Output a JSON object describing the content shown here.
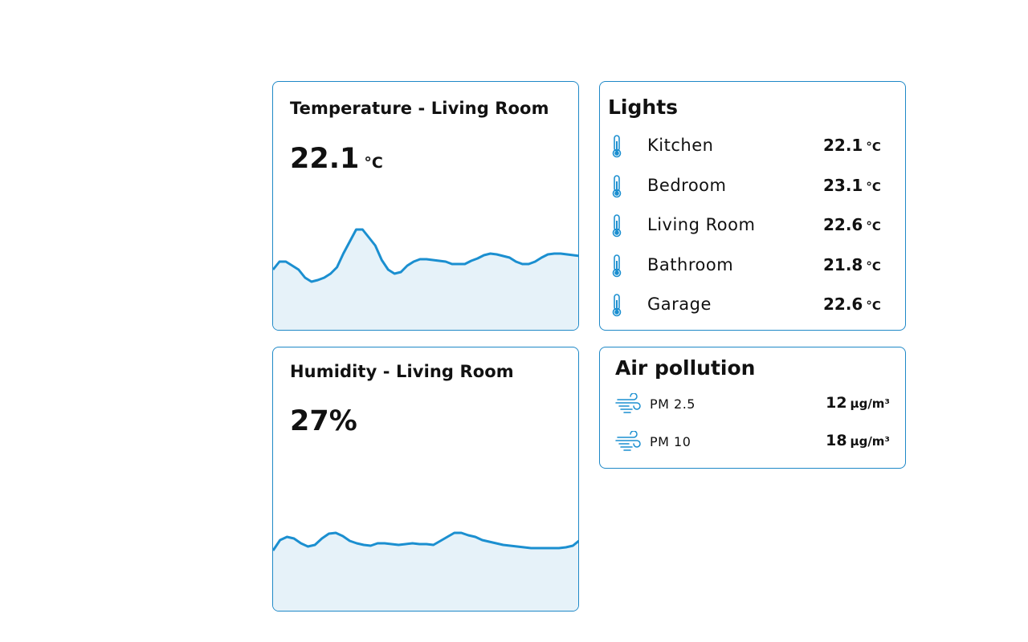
{
  "temperature_card": {
    "title": "Temperature - Living Room",
    "value": "22.1",
    "unit": "°C",
    "trend": [
      75,
      85,
      85,
      80,
      75,
      65,
      60,
      62,
      65,
      70,
      78,
      95,
      110,
      125,
      125,
      115,
      105,
      87,
      75,
      70,
      72,
      80,
      85,
      88,
      88,
      87,
      86,
      85,
      82,
      82,
      82,
      86,
      89,
      93,
      95,
      94,
      92,
      90,
      85,
      82,
      82,
      85,
      90,
      94,
      95,
      95,
      94,
      93,
      92
    ]
  },
  "humidity_card": {
    "title": "Humidity - Living Room",
    "value": "27%",
    "trend": [
      75,
      88,
      92,
      90,
      84,
      80,
      82,
      90,
      96,
      97,
      93,
      87,
      84,
      82,
      81,
      84,
      84,
      83,
      82,
      83,
      84,
      83,
      83,
      82,
      87,
      92,
      97,
      97,
      94,
      92,
      88,
      86,
      84,
      82,
      81,
      80,
      79,
      78,
      78,
      78,
      78,
      78,
      79,
      81,
      88
    ]
  },
  "lights_card": {
    "title": "Lights",
    "items": [
      {
        "room": "Kitchen",
        "value": "22.1",
        "unit": "°C",
        "icon": "thermometer-icon"
      },
      {
        "room": "Bedroom",
        "value": "23.1",
        "unit": "°C",
        "icon": "thermometer-icon"
      },
      {
        "room": "Living Room",
        "value": "22.6",
        "unit": "°C",
        "icon": "thermometer-icon"
      },
      {
        "room": "Bathroom",
        "value": "21.8",
        "unit": "°C",
        "icon": "thermometer-icon"
      },
      {
        "room": "Garage",
        "value": "22.6",
        "unit": "°C",
        "icon": "thermometer-icon"
      }
    ]
  },
  "air_card": {
    "title": "Air pollution",
    "items": [
      {
        "label": "PM 2.5",
        "value": "12",
        "unit": "µg/m³",
        "icon": "wind-icon"
      },
      {
        "label": "PM 10",
        "value": "18",
        "unit": "µg/m³",
        "icon": "wind-icon"
      }
    ]
  },
  "colors": {
    "accent": "#1e88c7",
    "line": "#1b8fd0",
    "fill": "#e6f2f9",
    "border": "#1e88c7"
  }
}
